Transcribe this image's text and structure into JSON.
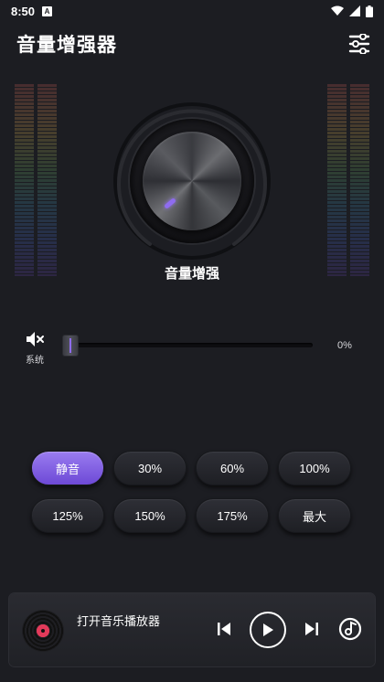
{
  "status_bar": {
    "time": "8:50",
    "app_icon": "A"
  },
  "header": {
    "title": "音量增强器",
    "settings_icon": "sliders-icon"
  },
  "knob": {
    "label": "音量增强",
    "accent_color": "#8f6cf0"
  },
  "slider": {
    "label": "系统",
    "value_text": "0%",
    "value": 0
  },
  "presets": [
    {
      "label": "静音",
      "active": true
    },
    {
      "label": "30%",
      "active": false
    },
    {
      "label": "60%",
      "active": false
    },
    {
      "label": "100%",
      "active": false
    },
    {
      "label": "125%",
      "active": false
    },
    {
      "label": "150%",
      "active": false
    },
    {
      "label": "175%",
      "active": false
    },
    {
      "label": "最大",
      "active": false
    }
  ],
  "player": {
    "label": "打开音乐播放器",
    "controls": [
      "previous-icon",
      "play-icon",
      "next-icon",
      "music-note-icon"
    ]
  },
  "colors": {
    "background": "#1c1d22",
    "accent": "#8f6cf0"
  }
}
